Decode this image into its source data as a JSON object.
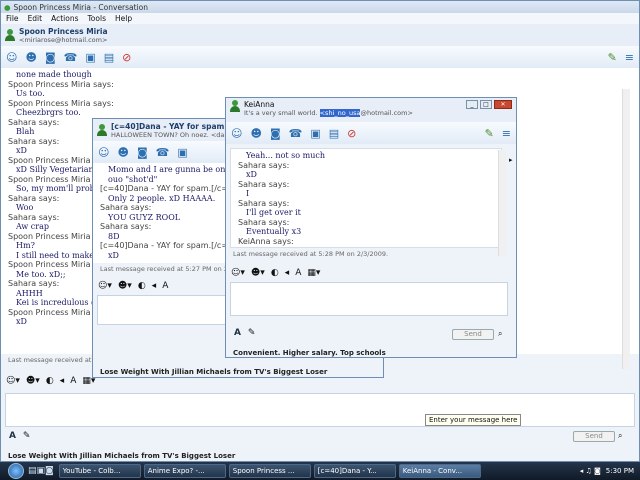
{
  "main": {
    "title": "Spoon Princess Miria - Conversation",
    "menu": [
      "File",
      "Edit",
      "Actions",
      "Tools",
      "Help"
    ],
    "contact_name": "Spoon Princess Miria",
    "contact_email": "<miriarose@hotmail.com>",
    "messages": [
      {
        "s": "",
        "m": "none made though"
      },
      {
        "s": "Spoon Princess Miria says:",
        "m": "Us too."
      },
      {
        "s": "Spoon Princess Miria says:",
        "m": "Cheezbrgrs too."
      },
      {
        "s": "Sahara says:",
        "m": "Blah"
      },
      {
        "s": "Sahara says:",
        "m": "xD"
      },
      {
        "s": "Spoon Princess Miria",
        "m": "xD Silly Vegetarian"
      },
      {
        "s": "Spoon Princess Miria",
        "m": "So, my mom'll prob"
      },
      {
        "s": "Sahara says:",
        "m": "Woo"
      },
      {
        "s": "Sahara says:",
        "m": "Aw crap"
      },
      {
        "s": "Spoon Princess Miria",
        "m": "Hm?"
      },
      {
        "s": "",
        "m": "I still need to make v"
      },
      {
        "s": "Spoon Princess Miria",
        "m": "Me too. xD;;"
      },
      {
        "s": "Sahara says:",
        "m": "AHHH"
      },
      {
        "s": "",
        "m": "Kei is incredulous @"
      },
      {
        "s": "Spoon Princess Miria",
        "m": "xD"
      }
    ],
    "last_received": "Last message received at 5",
    "input_tooltip": "Enter your message here",
    "send": "Send",
    "ad": "Lose Weight With Jillian Michaels from TV's Biggest Loser"
  },
  "dana": {
    "title": "[c=40]Dana - YAY for spam.[/c=",
    "subtitle": "HALLOWEEN TOWN? Oh noez. <danah",
    "messages": [
      {
        "s": "",
        "m": "Momo and I are gunna be one h"
      },
      {
        "s": "",
        "m": "ouo \"shot'd\""
      },
      {
        "s": "[c=40]Dana - YAY for spam.[/c=49",
        "m": "Only 2 people. xD HAAAA."
      },
      {
        "s": "Sahara says:",
        "m": "YOU GUYZ ROOL"
      },
      {
        "s": "Sahara says:",
        "m": "8D"
      },
      {
        "s": "[c=40]Dana - YAY for spam.[/c=49",
        "m": "xD"
      }
    ],
    "last_received": "Last message received at 5:27 PM on 2/3",
    "ad": "Lose Weight With Jillian Michaels from TV's Biggest Loser"
  },
  "kei": {
    "title": "KeiAnna",
    "psm": "It's a very small world.",
    "email_highlight": "<shi_no_usa",
    "email_rest": "@hotmail.com>",
    "messages": [
      {
        "s": "",
        "m": "Yeah... not so much"
      },
      {
        "s": "Sahara says:",
        "m": "xD"
      },
      {
        "s": "Sahara says:",
        "m": "I"
      },
      {
        "s": "Sahara says:",
        "m": "I'll get over it"
      },
      {
        "s": "Sahara says:",
        "m": "Eventually x3"
      },
      {
        "s": "KeiAnna says:",
        "m": "xD"
      }
    ],
    "last_received": "Last message received at 5:28 PM on 2/3/2009.",
    "send": "Send",
    "ad": "Convenient. Higher salary. Top schools"
  },
  "taskbar": {
    "items": [
      {
        "label": "YouTube - Colb...",
        "active": false
      },
      {
        "label": "Anime Expo? -...",
        "active": false
      },
      {
        "label": "Spoon Princess ...",
        "active": false
      },
      {
        "label": "[c=40]Dana - Y...",
        "active": false
      },
      {
        "label": "KeiAnna - Conv...",
        "active": true
      }
    ],
    "clock": "5:30 PM"
  },
  "colors": {
    "accent": "#2e6fb0",
    "message_text": "#1a1a66",
    "highlight": "#3366cc"
  }
}
